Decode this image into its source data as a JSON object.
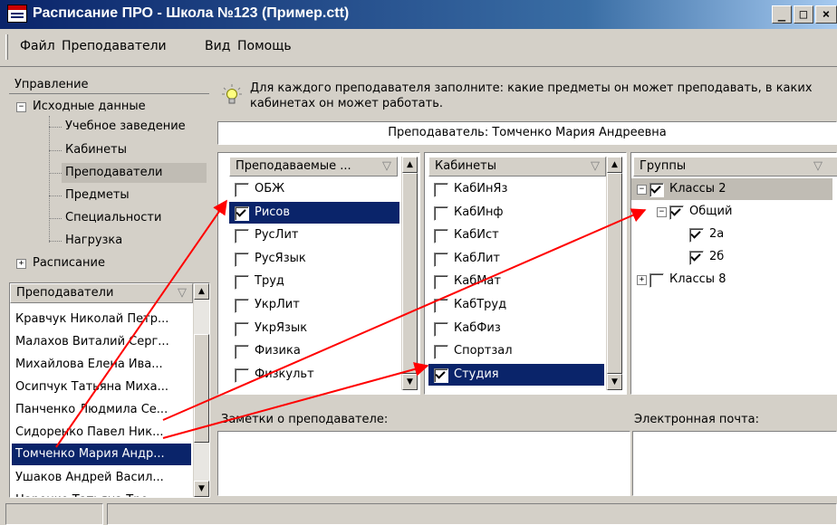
{
  "window": {
    "title": "Расписание ПРО - Школа №123 (Пример.ctt)"
  },
  "window_controls": {
    "minimize": "_",
    "maximize": "□",
    "close": "×"
  },
  "menu": [
    "Файл",
    "Преподаватели",
    "Вид",
    "Помощь"
  ],
  "nav": {
    "header": "Управление",
    "root": "Исходные данные",
    "root_toggle": "−",
    "items": [
      "Учебное заведение",
      "Кабинеты",
      "Преподаватели",
      "Предметы",
      "Специальности",
      "Нагрузка"
    ],
    "selected": "Преподаватели",
    "second_root": "Расписание",
    "second_toggle": "+"
  },
  "teachers": {
    "header": "Преподаватели",
    "items": [
      "Кравчук Николай Петр...",
      "Малахов Виталий Серг...",
      "Михайлова Елена Ива...",
      "Осипчук Татьяна Миха...",
      "Панченко Людмила Се...",
      "Сидоренко Павел Ник...",
      "Томченко Мария Андр...",
      "Ушаков Андрей Васил...",
      "Царенко Татьяна Тро..."
    ],
    "selected": "Томченко Мария Андр..."
  },
  "hint": "Для каждого преподавателя заполните: какие предметы он может преподавать, в каких кабинетах он может работать.",
  "current_teacher": "Преподаватель: Томченко Мария Андреевна",
  "subjects": {
    "header": "Преподаваемые ...",
    "items": [
      {
        "label": "ОБЖ",
        "checked": false
      },
      {
        "label": "Рисов",
        "checked": true,
        "selected": true
      },
      {
        "label": "РусЛит",
        "checked": false
      },
      {
        "label": "РусЯзык",
        "checked": false
      },
      {
        "label": "Труд",
        "checked": false
      },
      {
        "label": "УкрЛит",
        "checked": false
      },
      {
        "label": "УкрЯзык",
        "checked": false
      },
      {
        "label": "Физика",
        "checked": false
      },
      {
        "label": "Физкульт",
        "checked": false
      }
    ]
  },
  "rooms": {
    "header": "Кабинеты",
    "items": [
      {
        "label": "КабИнЯз",
        "checked": false
      },
      {
        "label": "КабИнф",
        "checked": false
      },
      {
        "label": "КабИст",
        "checked": false
      },
      {
        "label": "КабЛит",
        "checked": false
      },
      {
        "label": "КабМат",
        "checked": false
      },
      {
        "label": "КабТруд",
        "checked": false
      },
      {
        "label": "КабФиз",
        "checked": false
      },
      {
        "label": "Спортзал",
        "checked": false
      },
      {
        "label": "Студия",
        "checked": true,
        "selected": true
      }
    ]
  },
  "groups": {
    "header": "Группы",
    "items": [
      {
        "label": "Классы 2",
        "checked": true,
        "toggle": "−",
        "level": 0,
        "selected": true
      },
      {
        "label": "Общий",
        "checked": true,
        "toggle": "−",
        "level": 1
      },
      {
        "label": "2а",
        "checked": true,
        "level": 2
      },
      {
        "label": "2б",
        "checked": true,
        "level": 2
      },
      {
        "label": "Классы 8",
        "checked": false,
        "toggle": "+",
        "level": 0
      }
    ]
  },
  "notes": {
    "label": "Заметки о преподавателе:",
    "value": ""
  },
  "email": {
    "label": "Электронная почта:",
    "value": ""
  },
  "colors": {
    "selection": "#0a246a",
    "annotation_arrows": "#ff0000",
    "title_gradient_start": "#0a246a"
  },
  "icons": {
    "hint": "lightbulb-icon",
    "app": "schedule-app-icon"
  }
}
